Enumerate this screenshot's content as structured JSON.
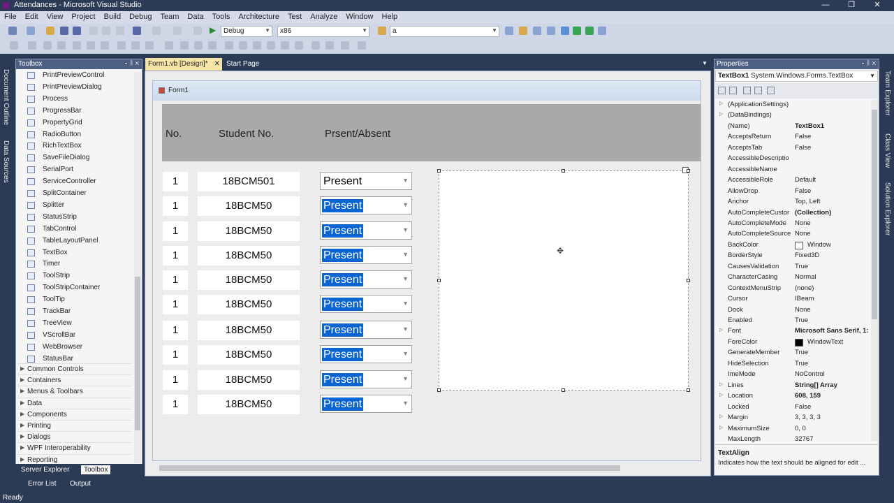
{
  "window": {
    "title": "Attendances - Microsoft Visual Studio",
    "min": "—",
    "max": "❐",
    "close": "✕"
  },
  "menu": [
    "File",
    "Edit",
    "View",
    "Project",
    "Build",
    "Debug",
    "Team",
    "Data",
    "Tools",
    "Architecture",
    "Test",
    "Analyze",
    "Window",
    "Help"
  ],
  "toolbar": {
    "config": "Debug",
    "platform": "x86",
    "find": "a"
  },
  "left_strip": [
    "Document Outline",
    "Data Sources"
  ],
  "right_strip": [
    "Team Explorer",
    "Class View",
    "Solution Explorer"
  ],
  "toolbox": {
    "title": "Toolbox",
    "pin": "▾ ᛒ ✕",
    "items": [
      "PrintPreviewControl",
      "PrintPreviewDialog",
      "Process",
      "ProgressBar",
      "PropertyGrid",
      "RadioButton",
      "RichTextBox",
      "SaveFileDialog",
      "SerialPort",
      "ServiceController",
      "SplitContainer",
      "Splitter",
      "StatusStrip",
      "TabControl",
      "TableLayoutPanel",
      "TextBox",
      "Timer",
      "ToolStrip",
      "ToolStripContainer",
      "ToolTip",
      "TrackBar",
      "TreeView",
      "VScrollBar",
      "WebBrowser",
      "StatusBar"
    ],
    "categories": [
      "Common Controls",
      "Containers",
      "Menus & Toolbars",
      "Data",
      "Components",
      "Printing",
      "Dialogs",
      "WPF Interoperability",
      "Reporting"
    ]
  },
  "bottom_tabs": {
    "server_explorer": "Server Explorer",
    "toolbox": "Toolbox",
    "error_list": "Error List",
    "output": "Output"
  },
  "doc_tabs": {
    "design": "Form1.vb [Design]*",
    "close": "✕",
    "start": "Start Page"
  },
  "form": {
    "title": "Form1",
    "headers": {
      "no": "No.",
      "student": "Student No.",
      "presence": "Prsent/Absent"
    },
    "rows": [
      {
        "no": "1",
        "student": "18BCM501",
        "status": "Present",
        "selected": false
      },
      {
        "no": "1",
        "student": "18BCM50",
        "status": "Present",
        "selected": true
      },
      {
        "no": "1",
        "student": "18BCM50",
        "status": "Present",
        "selected": true
      },
      {
        "no": "1",
        "student": "18BCM50",
        "status": "Present",
        "selected": true
      },
      {
        "no": "1",
        "student": "18BCM50",
        "status": "Present",
        "selected": true
      },
      {
        "no": "1",
        "student": "18BCM50",
        "status": "Present",
        "selected": true
      },
      {
        "no": "1",
        "student": "18BCM50",
        "status": "Present",
        "selected": true
      },
      {
        "no": "1",
        "student": "18BCM50",
        "status": "Present",
        "selected": true
      },
      {
        "no": "1",
        "student": "18BCM50",
        "status": "Present",
        "selected": true
      },
      {
        "no": "1",
        "student": "18BCM50",
        "status": "Present",
        "selected": true
      }
    ]
  },
  "properties": {
    "title": "Properties",
    "selector_name": "TextBox1",
    "selector_type": "System.Windows.Forms.TextBox",
    "rows": [
      {
        "n": "(ApplicationSettings)",
        "v": "",
        "exp": true
      },
      {
        "n": "(DataBindings)",
        "v": "",
        "exp": true
      },
      {
        "n": "(Name)",
        "v": "TextBox1",
        "bold": true
      },
      {
        "n": "AcceptsReturn",
        "v": "False"
      },
      {
        "n": "AcceptsTab",
        "v": "False"
      },
      {
        "n": "AccessibleDescriptio",
        "v": ""
      },
      {
        "n": "AccessibleName",
        "v": ""
      },
      {
        "n": "AccessibleRole",
        "v": "Default"
      },
      {
        "n": "AllowDrop",
        "v": "False"
      },
      {
        "n": "Anchor",
        "v": "Top, Left"
      },
      {
        "n": "AutoCompleteCustor",
        "v": "(Collection)",
        "bold": true
      },
      {
        "n": "AutoCompleteMode",
        "v": "None"
      },
      {
        "n": "AutoCompleteSource",
        "v": "None"
      },
      {
        "n": "BackColor",
        "v": "Window",
        "swatch": "#ffffff"
      },
      {
        "n": "BorderStyle",
        "v": "Fixed3D"
      },
      {
        "n": "CausesValidation",
        "v": "True"
      },
      {
        "n": "CharacterCasing",
        "v": "Normal"
      },
      {
        "n": "ContextMenuStrip",
        "v": "(none)"
      },
      {
        "n": "Cursor",
        "v": "IBeam"
      },
      {
        "n": "Dock",
        "v": "None"
      },
      {
        "n": "Enabled",
        "v": "True"
      },
      {
        "n": "Font",
        "v": "Microsoft Sans Serif, 1:",
        "bold": true,
        "exp": true
      },
      {
        "n": "ForeColor",
        "v": "WindowText",
        "swatch": "#000000"
      },
      {
        "n": "GenerateMember",
        "v": "True"
      },
      {
        "n": "HideSelection",
        "v": "True"
      },
      {
        "n": "ImeMode",
        "v": "NoControl"
      },
      {
        "n": "Lines",
        "v": "String[] Array",
        "bold": true,
        "exp": true
      },
      {
        "n": "Location",
        "v": "608, 159",
        "bold": true,
        "exp": true
      },
      {
        "n": "Locked",
        "v": "False"
      },
      {
        "n": "Margin",
        "v": "3, 3, 3, 3",
        "exp": true
      },
      {
        "n": "MaximumSize",
        "v": "0, 0",
        "exp": true
      },
      {
        "n": "MaxLength",
        "v": "32767"
      }
    ],
    "desc_title": "TextAlign",
    "desc_text": "Indicates how the text should be aligned for edit ..."
  },
  "status": "Ready",
  "colors": {
    "accent": "#2b3a55",
    "selection": "#0a64d2"
  }
}
